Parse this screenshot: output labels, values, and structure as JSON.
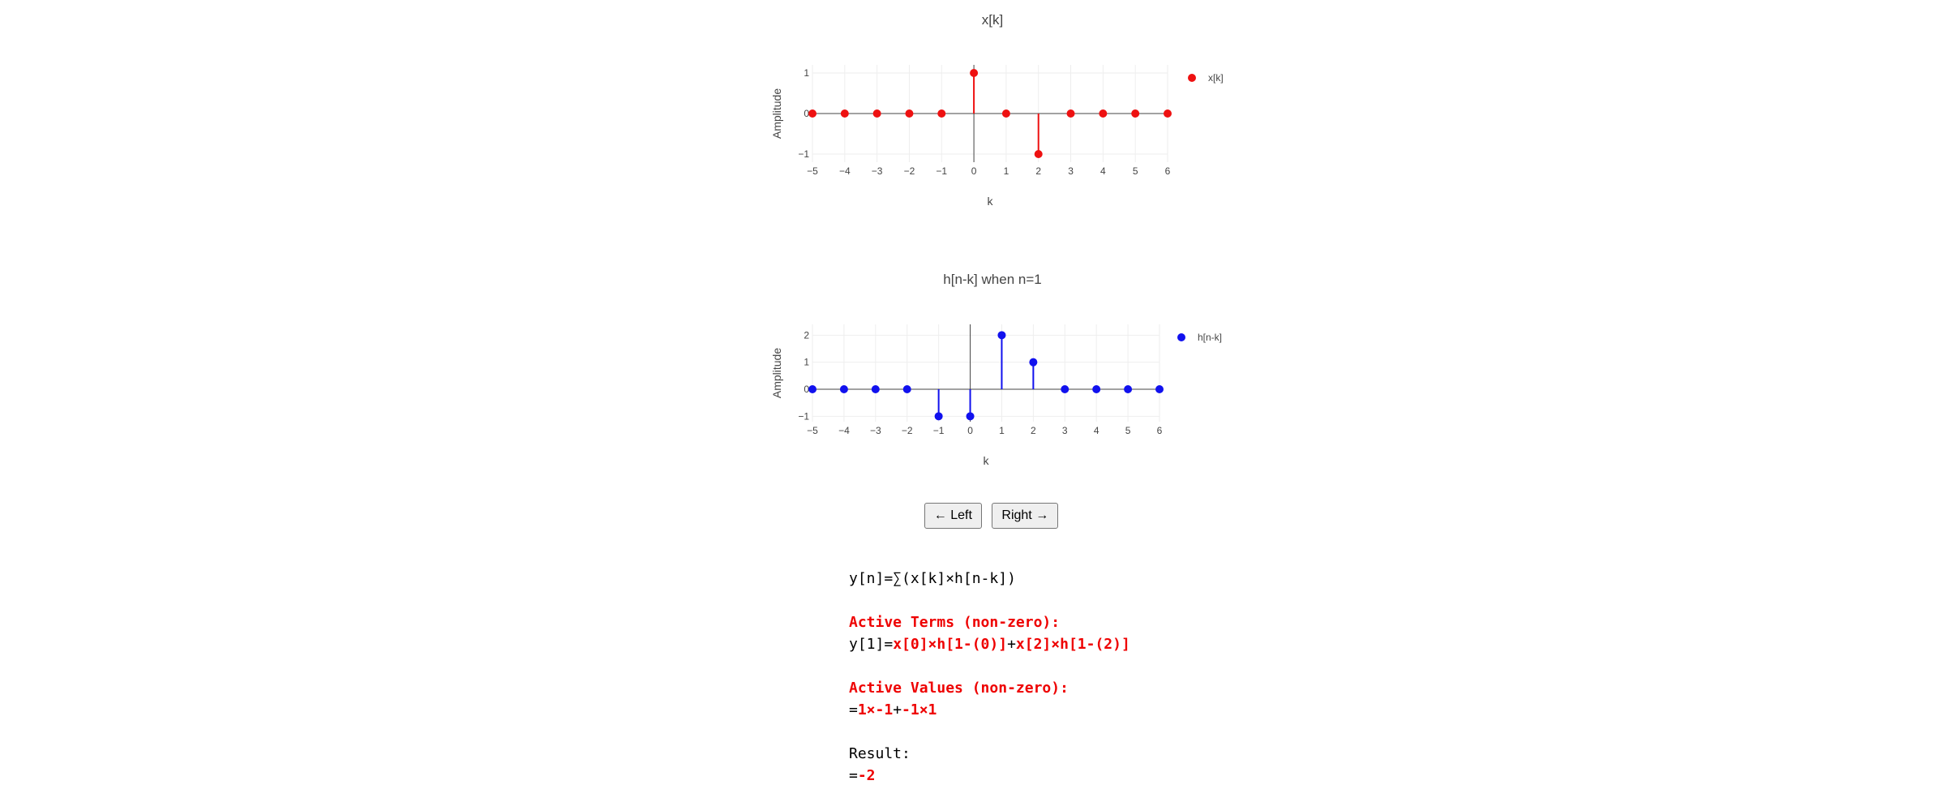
{
  "chart_data": [
    {
      "type": "stem",
      "title": "x[k]",
      "xlabel": "k",
      "ylabel": "Amplitude",
      "xlim": [
        -5,
        6
      ],
      "ylim": [
        -1.2,
        1.2
      ],
      "xticks": [
        -5,
        -4,
        -3,
        -2,
        -1,
        0,
        1,
        2,
        3,
        4,
        5,
        6
      ],
      "yticks": [
        -1,
        0,
        1
      ],
      "grid": true,
      "legend_position": "top-right",
      "series": [
        {
          "name": "x[k]",
          "color": "#ee1111",
          "x": [
            -5,
            -4,
            -3,
            -2,
            -1,
            0,
            1,
            2,
            3,
            4,
            5,
            6
          ],
          "y": [
            0,
            0,
            0,
            0,
            0,
            1,
            0,
            -1,
            0,
            0,
            0,
            0
          ]
        }
      ]
    },
    {
      "type": "stem",
      "title": "h[n-k] when n=1",
      "xlabel": "k",
      "ylabel": "Amplitude",
      "xlim": [
        -5,
        6
      ],
      "ylim": [
        -1.2,
        2.4
      ],
      "xticks": [
        -5,
        -4,
        -3,
        -2,
        -1,
        0,
        1,
        2,
        3,
        4,
        5,
        6
      ],
      "yticks": [
        -1,
        0,
        1,
        2
      ],
      "grid": true,
      "legend_position": "top-right",
      "series": [
        {
          "name": "h[n-k]",
          "color": "#1111ee",
          "x": [
            -5,
            -4,
            -3,
            -2,
            -1,
            0,
            1,
            2,
            3,
            4,
            5,
            6
          ],
          "y": [
            0,
            0,
            0,
            0,
            -1,
            -1,
            2,
            1,
            0,
            0,
            0,
            0
          ]
        }
      ]
    }
  ],
  "controls": {
    "left_label": "← Left",
    "right_label": "Right →"
  },
  "calculation": {
    "formula": "y[n]=∑(x[k]×h[n-k])",
    "terms_heading": "Active Terms (non-zero):",
    "terms_prefix": "y[1]=",
    "term1": "x[0]×h[1-(0)]",
    "terms_plus": "+",
    "term2": "x[2]×h[1-(2)]",
    "values_heading": "Active Values (non-zero):",
    "values_prefix": "=",
    "value1": "1×-1",
    "values_plus": "+",
    "value2": "-1×1",
    "result_heading": "Result:",
    "result_prefix": "=",
    "result_value": "-2"
  }
}
